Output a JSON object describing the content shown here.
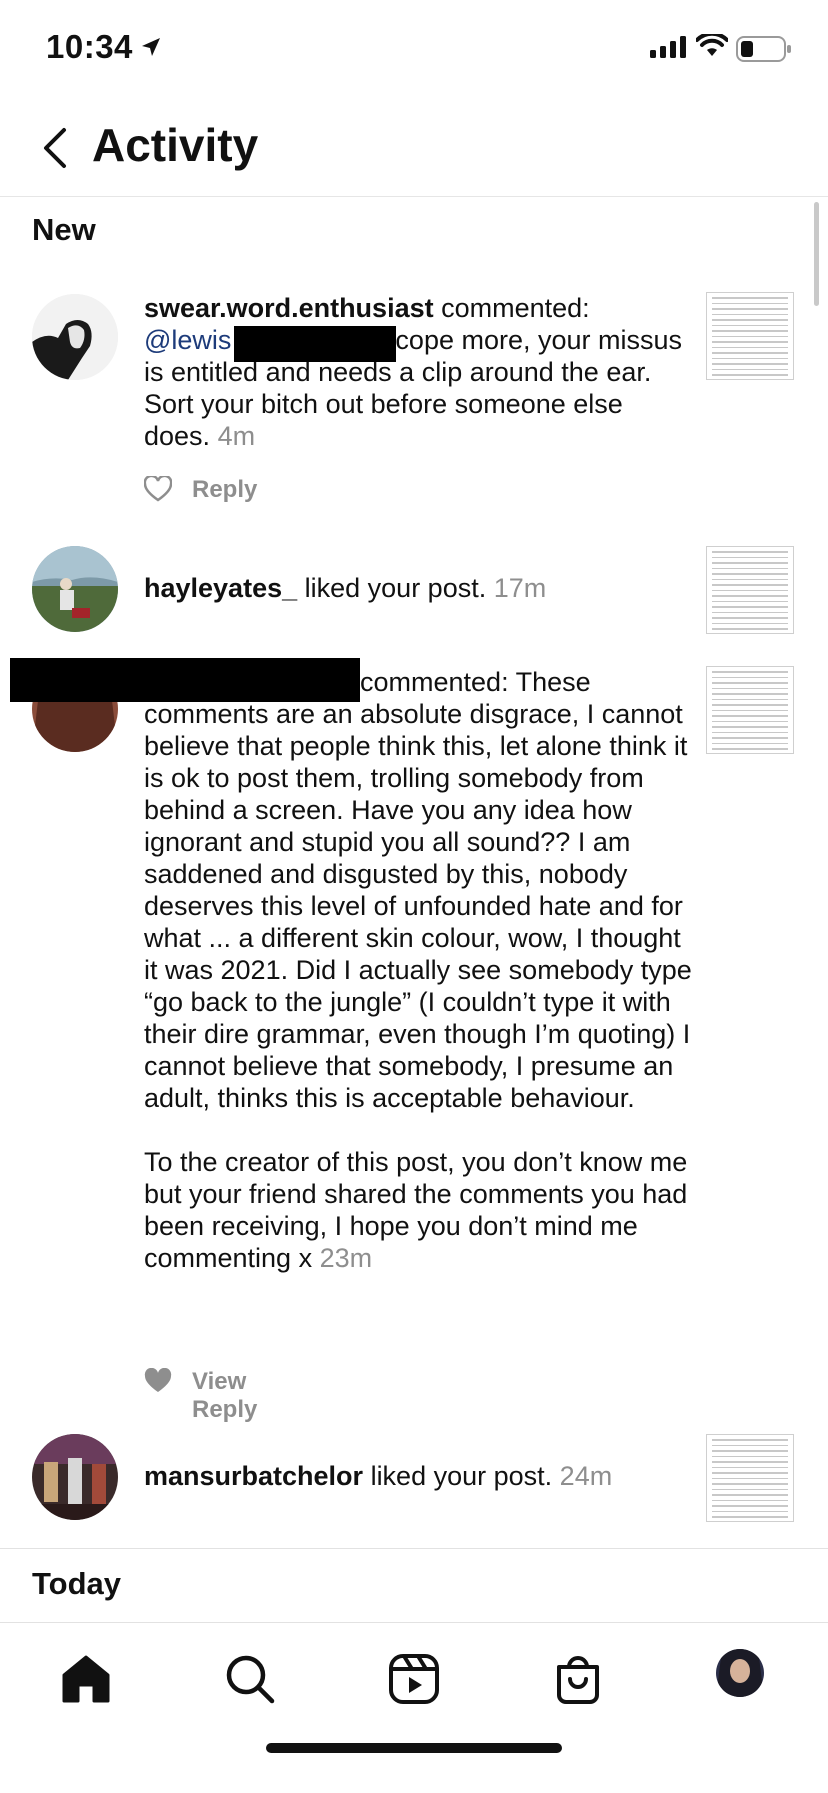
{
  "status_bar": {
    "time": "10:34"
  },
  "header": {
    "title": "Activity"
  },
  "sections": {
    "new_label": "New",
    "today_label": "Today"
  },
  "activities": [
    {
      "username": "swear.word.enthusiast",
      "action": " commented:",
      "mention": "@lewis",
      "comment_line1": "cope more, your",
      "comment_rest": "missus is entitled and needs a clip around the ear. Sort your bitch out before someone else does.",
      "time": "4m",
      "action_label": "Reply"
    },
    {
      "username": "hayleyates_",
      "action": " liked your post.",
      "time": "17m"
    },
    {
      "action": "commented: These",
      "comment_p1": "comments are an absolute disgrace, I cannot believe that people think this, let alone think it is ok to post them, trolling somebody from behind a screen.  Have you any idea how ignorant and stupid you all sound?? I am saddened and disgusted by this, nobody deserves this level of unfounded hate and for what ... a different skin colour, wow, I thought it was 2021.  Did I actually see somebody type “go back to the jungle” (I couldn’t type it with their dire grammar, even though I’m quoting) I cannot believe that somebody, I presume an adult, thinks this is acceptable behaviour.",
      "comment_p2": "To the creator of this post, you don’t know me but your friend shared the comments you had been receiving, I hope you don’t mind me commenting x",
      "time": "23m",
      "action_label": "View Reply"
    },
    {
      "username": "mansurbatchelor",
      "action": " liked your post.",
      "time": "24m"
    }
  ],
  "icons": {
    "back": "chevron-left-icon",
    "heart_outline": "heart-outline-icon",
    "heart_filled": "heart-filled-icon",
    "home": "home-icon",
    "search": "search-icon",
    "reels": "reels-icon",
    "shop": "shopping-bag-icon"
  },
  "colors": {
    "mention": "#1d3b7a",
    "timestamp": "#8e8e8e",
    "divider": "#e2e2e2"
  }
}
